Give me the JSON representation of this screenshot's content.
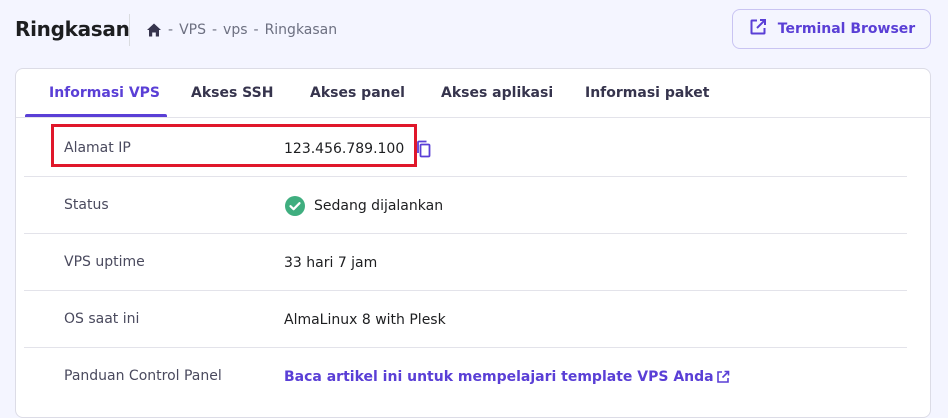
{
  "header": {
    "title": "Ringkasan",
    "breadcrumb": [
      "VPS",
      "vps",
      "Ringkasan"
    ],
    "terminal_button_label": "Terminal Browser"
  },
  "tabs": [
    {
      "label": "Informasi VPS",
      "active": true
    },
    {
      "label": "Akses SSH",
      "active": false
    },
    {
      "label": "Akses panel",
      "active": false
    },
    {
      "label": "Akses aplikasi",
      "active": false
    },
    {
      "label": "Informasi paket",
      "active": false
    }
  ],
  "info": {
    "ip": {
      "label": "Alamat IP",
      "value": "123.456.789.100"
    },
    "status": {
      "label": "Status",
      "value": "Sedang dijalankan"
    },
    "uptime": {
      "label": "VPS uptime",
      "value": "33 hari 7 jam"
    },
    "os": {
      "label": "OS saat ini",
      "value": "AlmaLinux 8 with Plesk"
    },
    "guide": {
      "label": "Panduan Control Panel",
      "value": "Baca artikel ini untuk mempelajari template VPS Anda"
    }
  },
  "colors": {
    "accent": "#5a3fd6",
    "status_ok": "#3fae7f",
    "highlight": "#e0172a"
  },
  "icons": {
    "home": "home-icon",
    "terminal": "external-link-icon",
    "copy": "copy-icon",
    "status": "check-circle-icon",
    "guide_link": "external-link-icon"
  }
}
